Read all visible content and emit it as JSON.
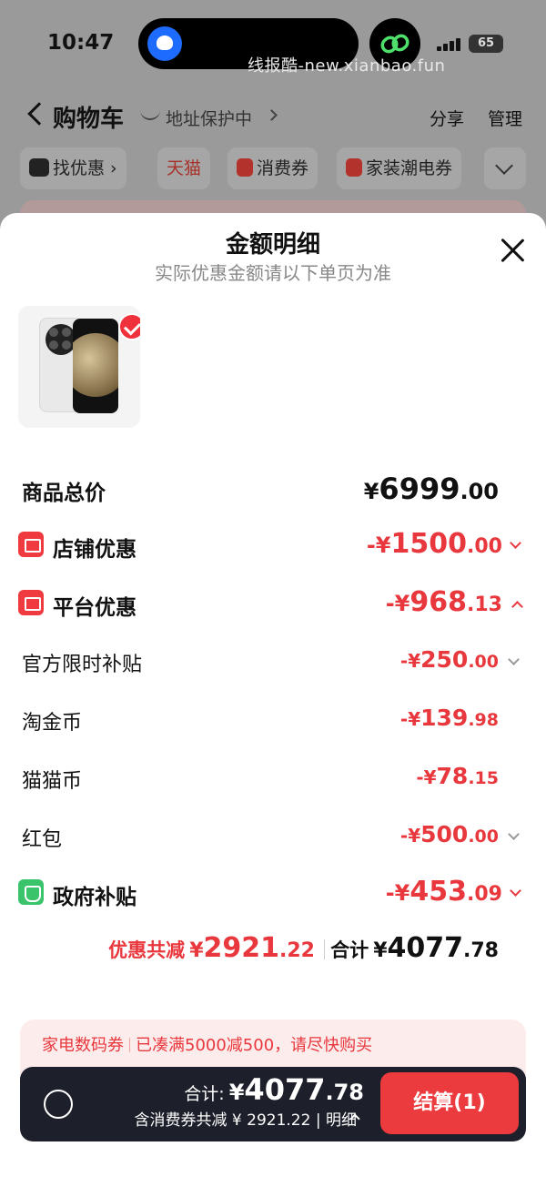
{
  "status_bar": {
    "time": "10:47",
    "battery": "65",
    "watermark": "线报酷-new.xianbao.fun"
  },
  "nav": {
    "title": "购物车",
    "address_status": "地址保护中",
    "share": "分享",
    "manage": "管理"
  },
  "filter_chips": [
    {
      "label": "找优惠",
      "icon": "alipay-cat-icon"
    },
    {
      "label": "天猫"
    },
    {
      "label": "消费券",
      "icon": "coupon-icon"
    },
    {
      "label": "家装潮电券",
      "icon": "coupon-icon"
    }
  ],
  "sheet": {
    "title": "金额明细",
    "subtitle": "实际优惠金额请以下单页为准"
  },
  "rows": {
    "goods_total": {
      "label": "商品总价",
      "currency": "¥",
      "int": "6999",
      "dec": ".00"
    },
    "store_discount": {
      "label": "店铺优惠",
      "prefix": "-¥",
      "int": "1500",
      "dec": ".00",
      "icon": "shop-icon"
    },
    "platform_discount": {
      "label": "平台优惠",
      "prefix": "-¥",
      "int": "968",
      "dec": ".13",
      "icon": "platform-icon"
    },
    "official_subsidy": {
      "label": "官方限时补贴",
      "prefix": "-¥",
      "int": "250",
      "dec": ".00"
    },
    "taojinbi": {
      "label": "淘金币",
      "prefix": "-¥",
      "int": "139",
      "dec": ".98"
    },
    "maomaobi": {
      "label": "猫猫币",
      "prefix": "-¥",
      "int": "78",
      "dec": ".15"
    },
    "red_packet": {
      "label": "红包",
      "prefix": "-¥",
      "int": "500",
      "dec": ".00"
    },
    "gov_subsidy": {
      "label": "政府补贴",
      "prefix": "-¥",
      "int": "453",
      "dec": ".09",
      "icon": "gov-subsidy-icon"
    }
  },
  "summary": {
    "discount_label": "优惠共减",
    "discount_currency": "¥",
    "discount_int": "2921",
    "discount_dec": ".22",
    "total_label": "合计",
    "total_currency": "¥",
    "total_int": "4077",
    "total_dec": ".78"
  },
  "promo": {
    "category": "家电数码券",
    "message": "已凑满5000减500，请尽快购买"
  },
  "checkout": {
    "total_label": "合计:",
    "currency": "¥",
    "total_int": "4077",
    "total_dec": ".78",
    "detail": "含消费券共减 ¥ 2921.22",
    "detail_link": "明细",
    "pay_button": "结算(1)"
  },
  "colors": {
    "accent_red": "#e8383d",
    "button_red": "#ec3b3e",
    "bar_dark": "#1d1f2b",
    "promo_bg": "#fdecec",
    "gov_green": "#39c36b"
  }
}
